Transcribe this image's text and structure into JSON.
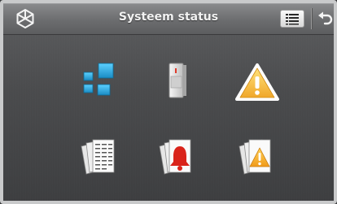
{
  "header": {
    "title": "Systeem status",
    "logo_icon": "brand-logo-icon",
    "list_button_icon": "list-icon",
    "back_button_icon": "back-arrow-icon"
  },
  "tiles": [
    {
      "icon": "zones-icon"
    },
    {
      "icon": "door-detector-icon"
    },
    {
      "icon": "warning-icon"
    },
    {
      "icon": "event-log-icon"
    },
    {
      "icon": "alarm-log-icon"
    },
    {
      "icon": "fault-log-icon"
    }
  ],
  "colors": {
    "zone_blue": "#25a9de",
    "warning_yellow": "#f6c43a",
    "alarm_red": "#d9231a"
  }
}
